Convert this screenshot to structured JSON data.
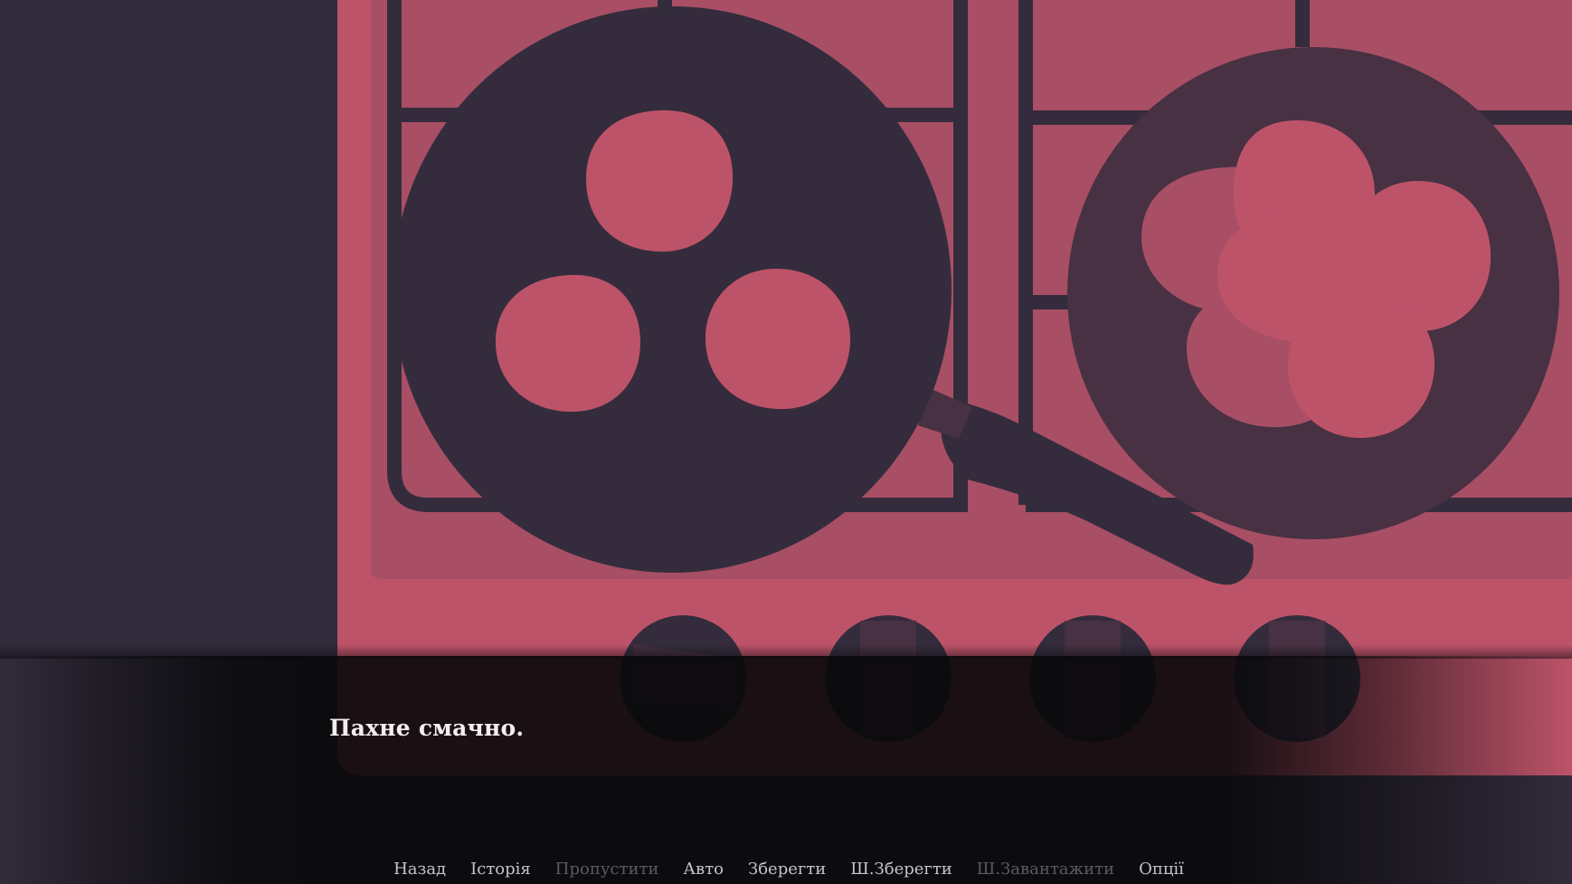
{
  "scene": {
    "colors": {
      "background": "#322b3b",
      "stove": "#bd5369",
      "stove_inner": "#a84f65",
      "grate": "#342c3c",
      "pan_left": "#342c3c",
      "pan_right": "#473142",
      "food": "#bd5369",
      "food_shadow": "#a84f65",
      "knob": "#342c3c"
    }
  },
  "dialogue": {
    "text": "Пахне смачно."
  },
  "quick_menu": {
    "items": [
      {
        "label": "Назад",
        "enabled": true
      },
      {
        "label": "Історія",
        "enabled": true
      },
      {
        "label": "Пропустити",
        "enabled": false
      },
      {
        "label": "Авто",
        "enabled": true
      },
      {
        "label": "Зберегти",
        "enabled": true
      },
      {
        "label": "Ш.Зберегти",
        "enabled": true
      },
      {
        "label": "Ш.Завантажити",
        "enabled": false
      },
      {
        "label": "Опції",
        "enabled": true
      }
    ]
  }
}
